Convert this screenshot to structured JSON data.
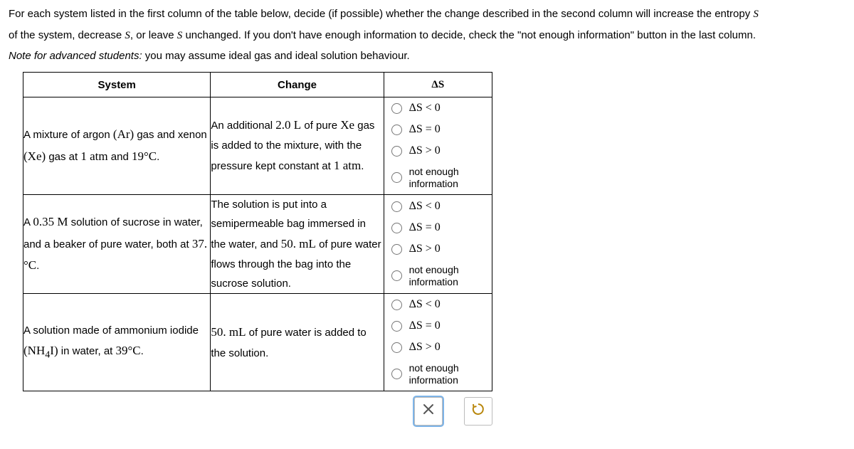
{
  "intro": {
    "line1_a": "For each system listed in the first column of the table below, decide (if possible) whether the change described in the second column will increase the entropy ",
    "S": "S",
    "line2_a": "of the system, decrease ",
    "line2_b": ", or leave ",
    "line2_c": " unchanged. If you don't have enough information to decide, check the \"not enough information\" button in the last column."
  },
  "note": {
    "prefix": "Note for advanced students:",
    "rest": " you may assume ideal gas and ideal solution behaviour."
  },
  "headers": {
    "system": "System",
    "change": "Change",
    "dS": "ΔS"
  },
  "options": {
    "lt": "ΔS < 0",
    "eq": "ΔS = 0",
    "gt": "ΔS > 0",
    "nei1": "not enough",
    "nei2": "information"
  },
  "rows": [
    {
      "system": {
        "p1": "A mixture of argon ",
        "p2": "(Ar)",
        "p3": " gas and xenon ",
        "p4": "(Xe)",
        "p5": " gas at ",
        "p6": "1 atm",
        "p7": " and ",
        "p8": "19°C",
        "p9": "."
      },
      "change": {
        "p1": "An additional ",
        "p2": "2.0 L",
        "p3": " of pure ",
        "p4": "Xe",
        "p5": " gas is added to the mixture, with the pressure kept constant at ",
        "p6": "1 atm",
        "p7": "."
      }
    },
    {
      "system": {
        "p1": "A ",
        "p2": "0.35 M",
        "p3": " solution of sucrose in water, and a beaker of pure water, both at ",
        "p4": "37.°C",
        "p5": "."
      },
      "change": {
        "p1": "The solution is put into a semipermeable bag immersed in the water, and ",
        "p2": "50. mL",
        "p3": " of pure water flows through the bag into the sucrose solution."
      }
    },
    {
      "system": {
        "p1": "A solution made of ammonium iodide ",
        "p2": "(NH",
        "sub": "4",
        "p3": "I)",
        "p4": " in water, at ",
        "p5": "39°C",
        "p6": "."
      },
      "change": {
        "p1": "",
        "p2": "50. mL",
        "p3": " of pure water is added to the solution."
      }
    }
  ]
}
